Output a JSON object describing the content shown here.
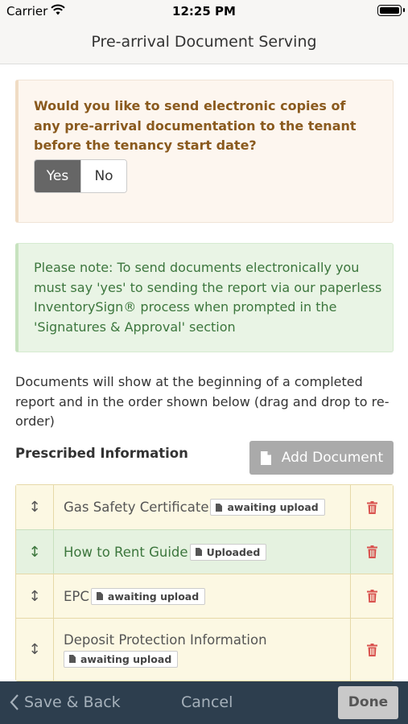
{
  "status_bar": {
    "carrier": "Carrier",
    "time": "12:25 PM"
  },
  "nav": {
    "title": "Pre-arrival Document Serving"
  },
  "question": {
    "text": "Would you like to send electronic copies of any pre-arrival documentation to the tenant before the tenancy start date?",
    "options": [
      {
        "label": "Yes",
        "selected": true
      },
      {
        "label": "No",
        "selected": false
      }
    ]
  },
  "note": {
    "text": "Please note: To send documents electronically you must say 'yes' to sending the report via our paperless InventorySign® process when prompted in the 'Signatures & Approval' section"
  },
  "info": {
    "text": "Documents will show at the beginning of a completed report and in the order shown below (drag and drop to re-order)"
  },
  "section": {
    "heading": "Prescribed Information",
    "add_button": "Add Document"
  },
  "documents": [
    {
      "title": "Gas Safety Certificate",
      "status": "awaiting upload"
    },
    {
      "title": "How to Rent Guide",
      "status": "Uploaded"
    },
    {
      "title": "EPC",
      "status": "awaiting upload"
    },
    {
      "title": "Deposit Protection Information",
      "status": "awaiting upload"
    }
  ],
  "bottom_bar": {
    "back": "Save & Back",
    "cancel": "Cancel",
    "done": "Done"
  },
  "colors": {
    "question_bg": "#fdf6ef",
    "question_text": "#8a5a1e",
    "note_bg": "#e9f4e5",
    "note_text": "#3c763d",
    "row_pending_bg": "#fcf8e3",
    "row_uploaded_bg": "#e5f2e0",
    "delete_icon": "#d9534f",
    "bottom_bar_bg": "#2d3e4e"
  },
  "icons": {
    "drag_handle": "arrows-vertical-icon",
    "delete": "trash-icon",
    "document": "file-icon",
    "back": "chevron-left-icon"
  }
}
